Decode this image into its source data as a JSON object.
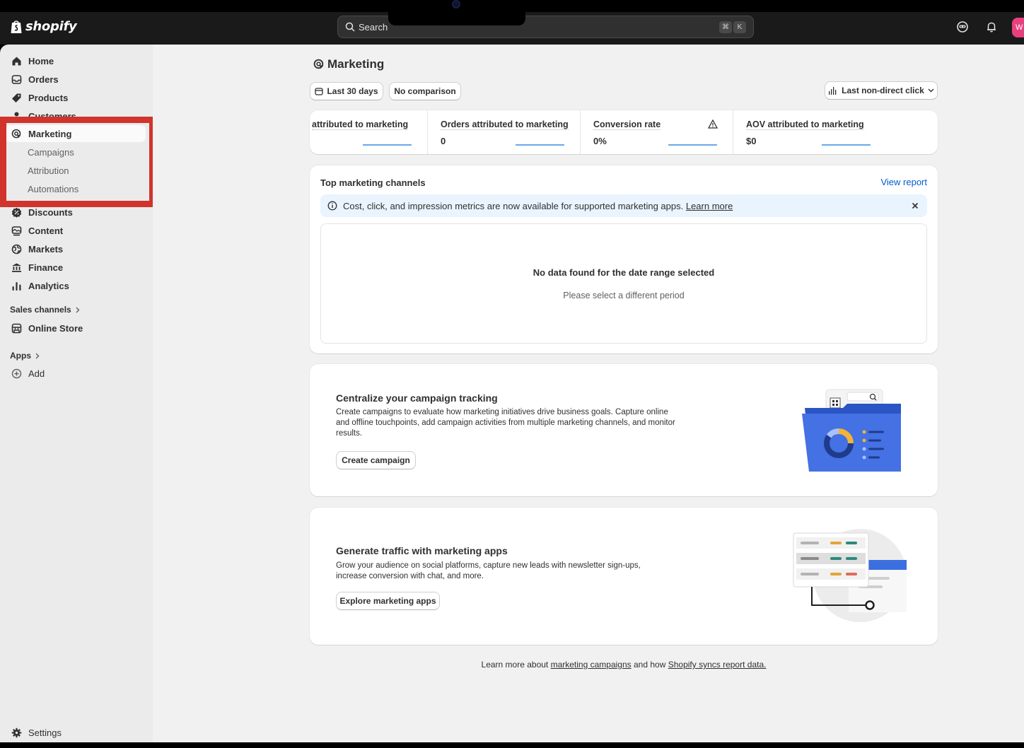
{
  "topbar": {
    "brand": "shopify",
    "search_placeholder": "Search",
    "shortcut_cmd": "⌘",
    "shortcut_key": "K",
    "avatar_initial": "W"
  },
  "sidebar": {
    "items": [
      {
        "label": "Home",
        "icon": "home-icon"
      },
      {
        "label": "Orders",
        "icon": "inbox-icon"
      },
      {
        "label": "Products",
        "icon": "tag-icon"
      },
      {
        "label": "Customers",
        "icon": "person-icon"
      },
      {
        "label": "Marketing",
        "icon": "target-icon"
      },
      {
        "label": "Discounts",
        "icon": "discount-icon"
      },
      {
        "label": "Content",
        "icon": "content-icon"
      },
      {
        "label": "Markets",
        "icon": "globe-icon"
      },
      {
        "label": "Finance",
        "icon": "bank-icon"
      },
      {
        "label": "Analytics",
        "icon": "bar-chart-icon"
      }
    ],
    "marketing_sub": [
      "Campaigns",
      "Attribution",
      "Automations"
    ],
    "sales_channels_label": "Sales channels",
    "online_store": "Online Store",
    "apps_label": "Apps",
    "add_label": "Add",
    "settings_label": "Settings"
  },
  "page": {
    "title": "Marketing",
    "date_range": "Last 30 days",
    "comparison": "No comparison",
    "attribution_model": "Last non-direct click"
  },
  "metrics": [
    {
      "label": "attributed to marketing",
      "value": ""
    },
    {
      "label": "Orders attributed to marketing",
      "value": "0"
    },
    {
      "label": "Conversion rate",
      "value": "0%"
    },
    {
      "label": "AOV attributed to marketing",
      "value": "$0"
    }
  ],
  "channels": {
    "title": "Top marketing channels",
    "view_report": "View report",
    "banner_text": "Cost, click, and impression metrics are now available for supported marketing apps.",
    "banner_link": "Learn more",
    "empty_title": "No data found for the date range selected",
    "empty_sub": "Please select a different period"
  },
  "campaign_card": {
    "title": "Centralize your campaign tracking",
    "desc": "Create campaigns to evaluate how marketing initiatives drive business goals. Capture online and offline touchpoints, add campaign activities from multiple marketing channels, and monitor results.",
    "button": "Create campaign"
  },
  "apps_card": {
    "title": "Generate traffic with marketing apps",
    "desc": "Grow your audience on social platforms, capture new leads with newsletter sign-ups, increase conversion with chat, and more.",
    "button": "Explore marketing apps"
  },
  "footer": {
    "prefix": "Learn more about",
    "link1": "marketing campaigns",
    "middle": "and how",
    "link2": "Shopify syncs report data."
  },
  "colors": {
    "accent_blue": "#005bd3",
    "highlight_red": "#d0342c",
    "illustration_blue": "#3d6ee6"
  }
}
